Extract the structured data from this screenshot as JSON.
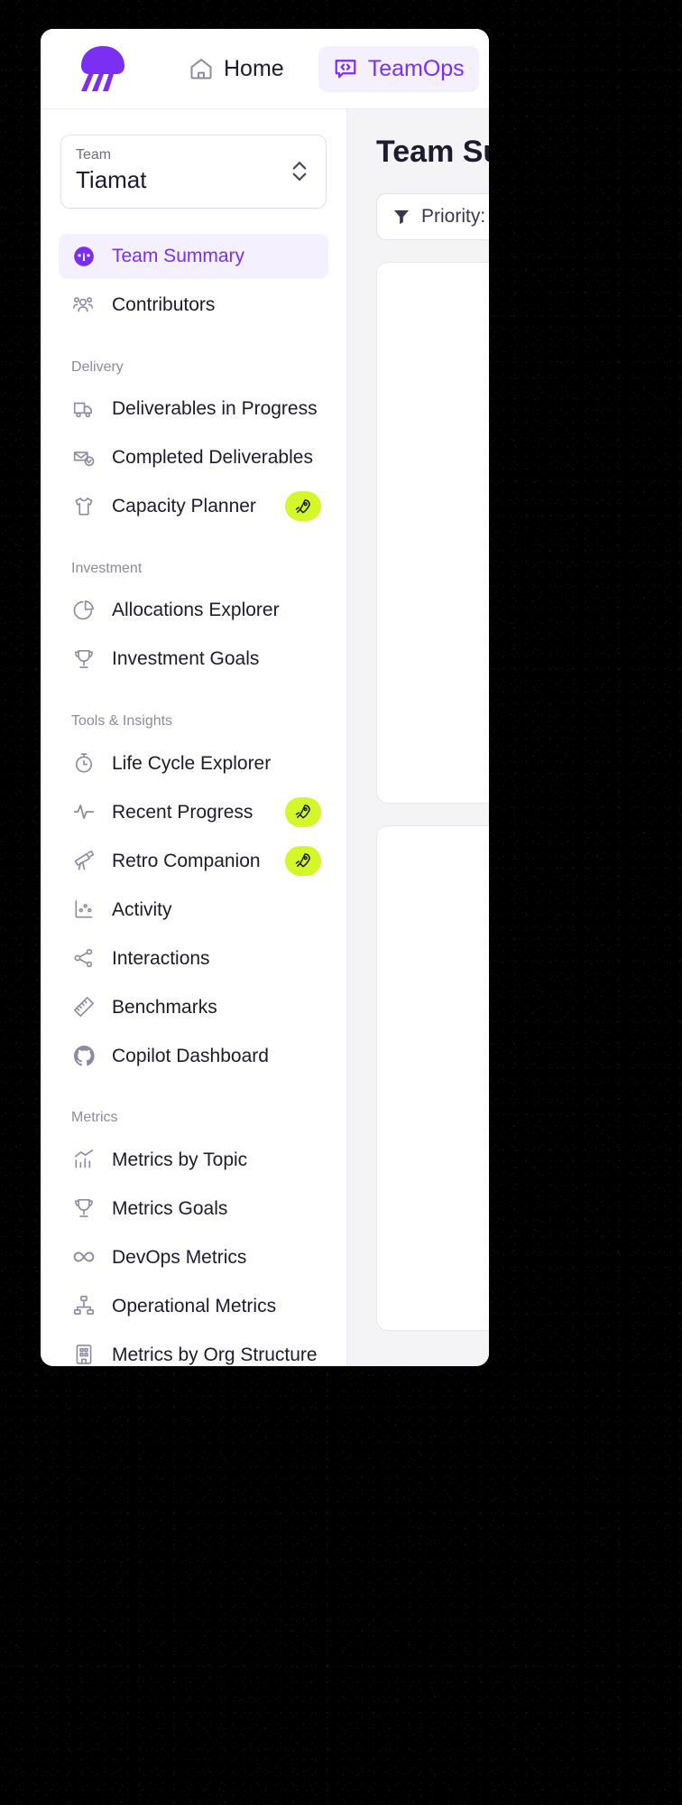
{
  "app": {
    "brand_icon": "jellyfish-logo",
    "accent_color": "#7b2ff2",
    "badge_color": "#d4f72a"
  },
  "topbar": {
    "tabs": [
      {
        "label": "Home",
        "icon": "home-icon",
        "active": false
      },
      {
        "label": "TeamOps",
        "icon": "code-chat-icon",
        "active": true
      }
    ]
  },
  "sidebar": {
    "team_selector": {
      "label": "Team",
      "value": "Tiamat",
      "icon": "chevron-up-down-icon"
    },
    "groups": [
      {
        "title": "",
        "items": [
          {
            "label": "Team Summary",
            "icon": "gauge-icon",
            "active": true,
            "badge": ""
          },
          {
            "label": "Contributors",
            "icon": "users-icon",
            "active": false,
            "badge": ""
          }
        ]
      },
      {
        "title": "Delivery",
        "items": [
          {
            "label": "Deliverables in Progress",
            "icon": "truck-icon",
            "active": false,
            "badge": ""
          },
          {
            "label": "Completed Deliverables",
            "icon": "mail-check-icon",
            "active": false,
            "badge": ""
          },
          {
            "label": "Capacity Planner",
            "icon": "tshirt-icon",
            "active": false,
            "badge": "rocket-icon"
          }
        ]
      },
      {
        "title": "Investment",
        "items": [
          {
            "label": "Allocations Explorer",
            "icon": "pie-chart-icon",
            "active": false,
            "badge": ""
          },
          {
            "label": "Investment Goals",
            "icon": "trophy-icon",
            "active": false,
            "badge": ""
          }
        ]
      },
      {
        "title": "Tools & Insights",
        "items": [
          {
            "label": "Life Cycle Explorer",
            "icon": "stopwatch-icon",
            "active": false,
            "badge": ""
          },
          {
            "label": "Recent Progress",
            "icon": "pulse-icon",
            "active": false,
            "badge": "rocket-icon"
          },
          {
            "label": "Retro Companion",
            "icon": "telescope-icon",
            "active": false,
            "badge": "rocket-icon"
          },
          {
            "label": "Activity",
            "icon": "activity-scatter-icon",
            "active": false,
            "badge": ""
          },
          {
            "label": "Interactions",
            "icon": "share-nodes-icon",
            "active": false,
            "badge": ""
          },
          {
            "label": "Benchmarks",
            "icon": "ruler-icon",
            "active": false,
            "badge": ""
          },
          {
            "label": "Copilot Dashboard",
            "icon": "github-icon",
            "active": false,
            "badge": ""
          }
        ]
      },
      {
        "title": "Metrics",
        "items": [
          {
            "label": "Metrics by Topic",
            "icon": "bar-chart-up-icon",
            "active": false,
            "badge": ""
          },
          {
            "label": "Metrics Goals",
            "icon": "trophy-icon",
            "active": false,
            "badge": ""
          },
          {
            "label": "DevOps Metrics",
            "icon": "infinity-icon",
            "active": false,
            "badge": ""
          },
          {
            "label": "Operational Metrics",
            "icon": "org-tree-icon",
            "active": false,
            "badge": ""
          },
          {
            "label": "Metrics by Org Structure",
            "icon": "building-icon",
            "active": false,
            "badge": ""
          }
        ]
      }
    ]
  },
  "main": {
    "title": "Team Su",
    "filter": {
      "icon": "funnel-icon",
      "label": "Priority:"
    }
  }
}
